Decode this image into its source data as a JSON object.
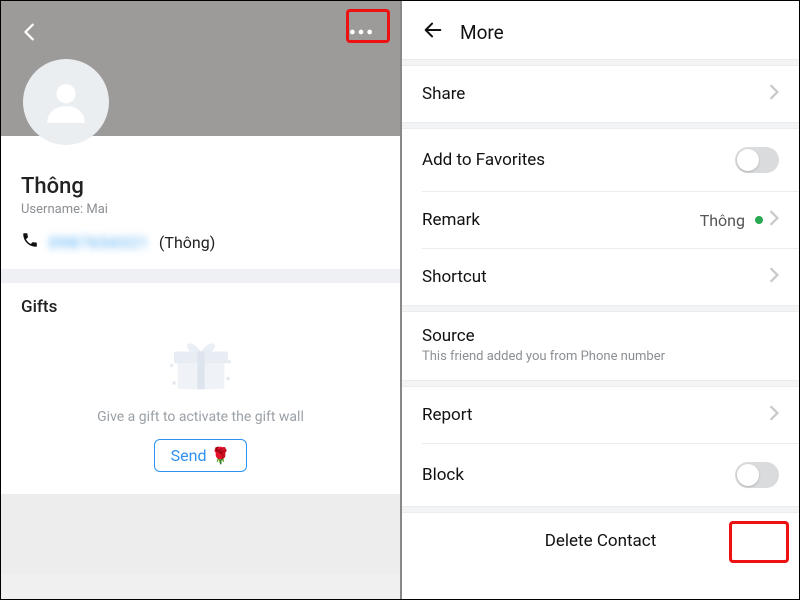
{
  "left": {
    "name": "Thông",
    "username_label": "Username: Mai",
    "phone_masked": "0987654321",
    "phone_suffix": "(Thông)",
    "gifts_title": "Gifts",
    "gifts_caption": "Give a gift to activate the gift wall",
    "send_label": "Send 🌹"
  },
  "right": {
    "title": "More",
    "share": "Share",
    "add_fav": "Add to Favorites",
    "remark": "Remark",
    "remark_value": "Thông",
    "shortcut": "Shortcut",
    "source_label": "Source",
    "source_sub": "This friend added you from Phone number",
    "report": "Report",
    "block": "Block",
    "delete": "Delete Contact"
  }
}
